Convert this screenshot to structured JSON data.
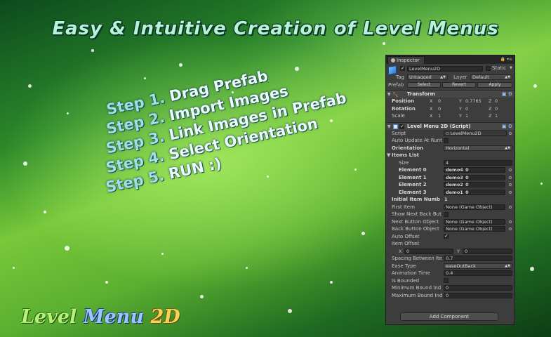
{
  "headline": "Easy & Intuitive Creation of Level Menus",
  "steps": [
    {
      "num": "Step 1.",
      "text": "Drag Prefab"
    },
    {
      "num": "Step 2.",
      "text": "Import Images"
    },
    {
      "num": "Step 3.",
      "text": "Link Images in Prefab"
    },
    {
      "num": "Step 4.",
      "text": "Select Orientation"
    },
    {
      "num": "Step 5.",
      "text": "RUN :)"
    }
  ],
  "logo": {
    "word1": "Level",
    "word2": "Menu",
    "word3": "2D"
  },
  "inspector": {
    "tab": "Inspector",
    "object_name": "LevelMenu2D",
    "static_label": "Static",
    "tag_label": "Tag",
    "tag_value": "Untagged",
    "layer_label": "Layer",
    "layer_value": "Default",
    "prefab_label": "Prefab",
    "prefab_select": "Select",
    "prefab_revert": "Revert",
    "prefab_apply": "Apply",
    "transform": {
      "title": "Transform",
      "position_label": "Position",
      "position": {
        "x": "0",
        "y": "0.7765",
        "z": "0"
      },
      "rotation_label": "Rotation",
      "rotation": {
        "x": "0",
        "y": "0",
        "z": "0"
      },
      "scale_label": "Scale",
      "scale": {
        "x": "1",
        "y": "1",
        "z": "1"
      }
    },
    "script_component": {
      "title": "Level Menu 2D (Script)",
      "script_label": "Script",
      "script_value": "LevelMenu2D",
      "auto_update_label": "Auto Update At Runt",
      "orientation_label": "Orientation",
      "orientation_value": "Horizontal",
      "items_list_label": "Items List",
      "size_label": "Size",
      "size_value": "4",
      "elements": [
        {
          "label": "Element 0",
          "value": "demo4_0"
        },
        {
          "label": "Element 1",
          "value": "demo3_0"
        },
        {
          "label": "Element 2",
          "value": "demo2_0"
        },
        {
          "label": "Element 3",
          "value": "demo1_0"
        }
      ],
      "initial_item_label": "Initial Item Numb",
      "initial_item_value": "1",
      "first_item_label": "First Item",
      "first_item_value": "None (Game Object)",
      "show_next_back_label": "Show Next Back But",
      "next_button_label": "Next Button Object",
      "next_button_value": "None (Game Object)",
      "back_button_label": "Back Button Object",
      "back_button_value": "None (Game Object)",
      "auto_offset_label": "Auto Offset",
      "auto_offset_check": "✓",
      "item_offset_label": "Item Offset",
      "item_offset": {
        "x": "0",
        "y": "0"
      },
      "spacing_label": "Spacing Between Ite",
      "spacing_value": "0.7",
      "ease_type_label": "Ease Type",
      "ease_type_value": "easeOutBack",
      "animation_time_label": "Animation Time",
      "animation_time_value": "0.4",
      "is_bounded_label": "Is Bounded",
      "min_bound_label": "Minimum Bound Ind",
      "min_bound_value": "0",
      "max_bound_label": "Maximum Bound Ind",
      "max_bound_value": "0"
    },
    "add_component": "Add Component"
  }
}
